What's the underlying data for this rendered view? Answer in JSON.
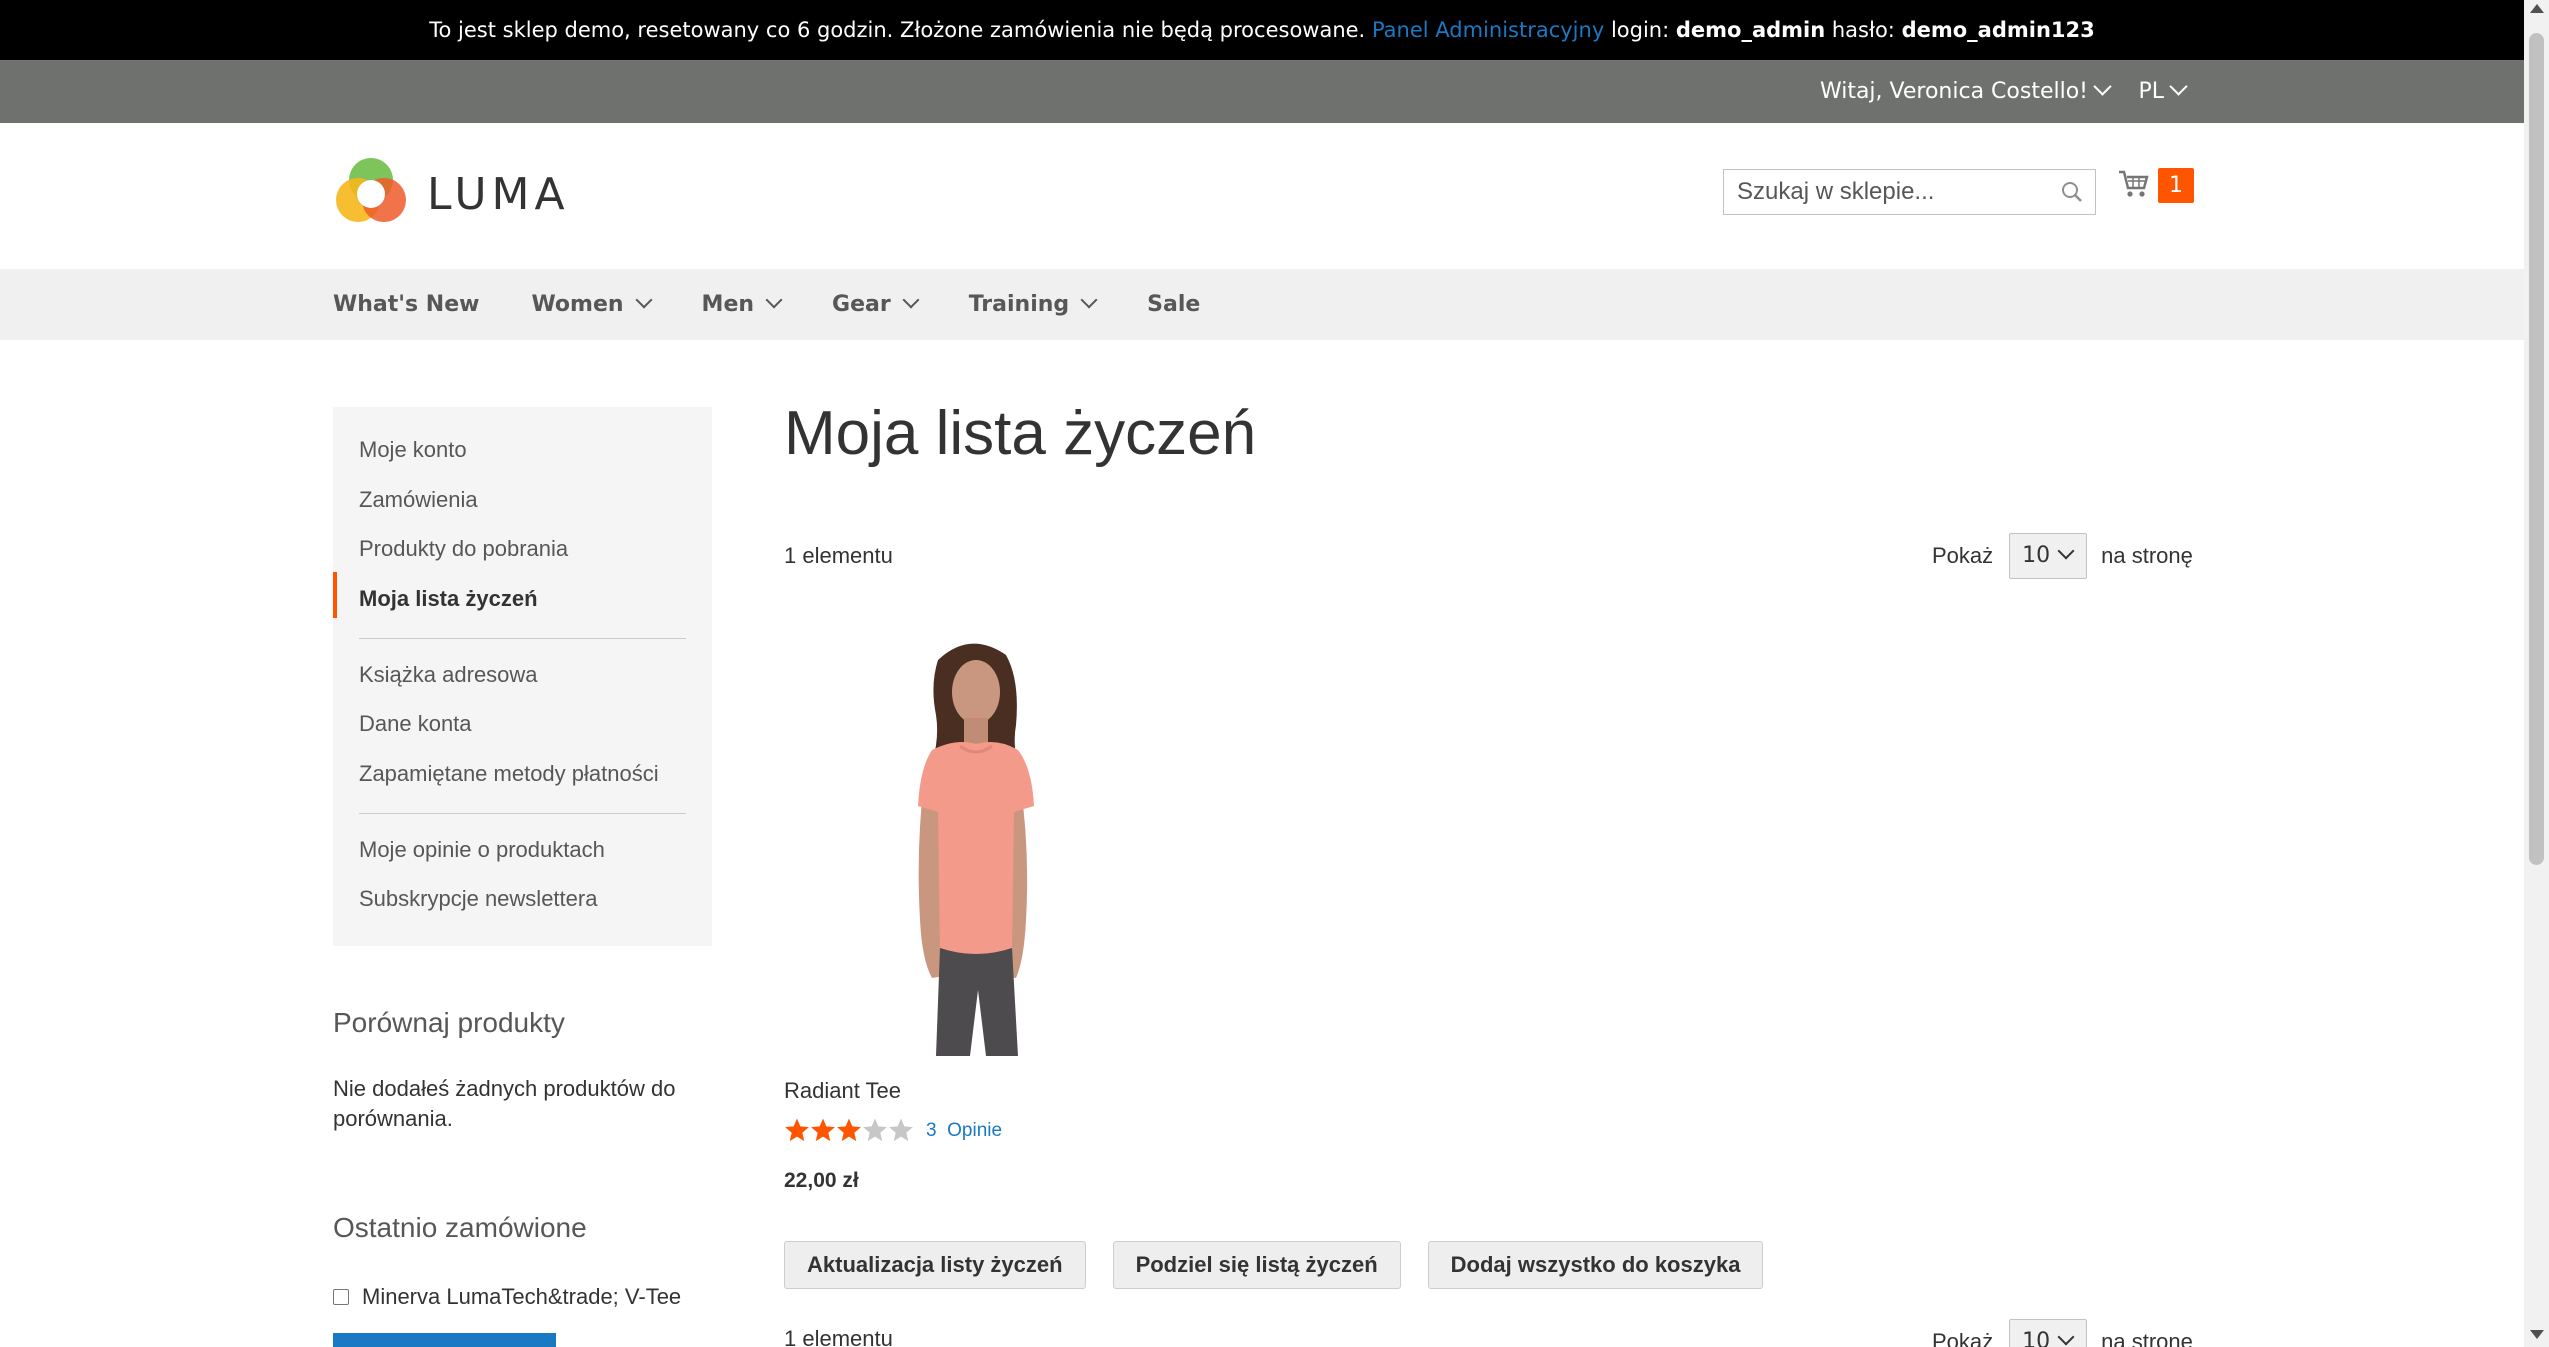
{
  "demo_bar": {
    "text": "To jest sklep demo, resetowany co 6 godzin. Złożone zamówienia nie będą procesowane.",
    "admin_link": "Panel Administracyjny",
    "login_label": "login:",
    "login_value": "demo_admin",
    "password_label": "hasło:",
    "password_value": "demo_admin123"
  },
  "panel_header": {
    "greeting": "Witaj, Veronica Costello!",
    "language": "PL"
  },
  "header": {
    "logo_text": "LUMA",
    "search_placeholder": "Szukaj w sklepie...",
    "cart_count": "1"
  },
  "nav": {
    "items": [
      {
        "label": "What's New"
      },
      {
        "label": "Women"
      },
      {
        "label": "Men"
      },
      {
        "label": "Gear"
      },
      {
        "label": "Training"
      },
      {
        "label": "Sale"
      }
    ]
  },
  "account_nav": {
    "items": [
      "Moje konto",
      "Zamówienia",
      "Produkty do pobrania",
      "Moja lista życzeń",
      "Książka adresowa",
      "Dane konta",
      "Zapamiętane metody płatności",
      "Moje opinie o produktach",
      "Subskrypcje newslettera"
    ],
    "active": "Moja lista życzeń"
  },
  "compare": {
    "title": "Porównaj produkty",
    "empty_text": "Nie dodałeś żadnych produktów do porównania."
  },
  "recent_orders": {
    "title": "Ostatnio zamówione",
    "item": "Minerva LumaTech&trade; V-Tee"
  },
  "main": {
    "title": "Moja lista życzeń",
    "item_count": "1 elementu",
    "show_label": "Pokaż",
    "per_page_value": "10",
    "per_page_suffix": "na stronę"
  },
  "product": {
    "name": "Radiant Tee",
    "rating": 3,
    "rating_max": 5,
    "reviews_count": "3",
    "reviews_label": "Opinie",
    "price": "22,00 zł"
  },
  "actions": {
    "update": "Aktualizacja listy życzeń",
    "share": "Podziel się listą życzeń",
    "add_all": "Dodaj wszystko do koszyka"
  },
  "colors": {
    "accent": "#ff5501",
    "link": "#1979c3",
    "star_off": "#c7c7c7"
  }
}
